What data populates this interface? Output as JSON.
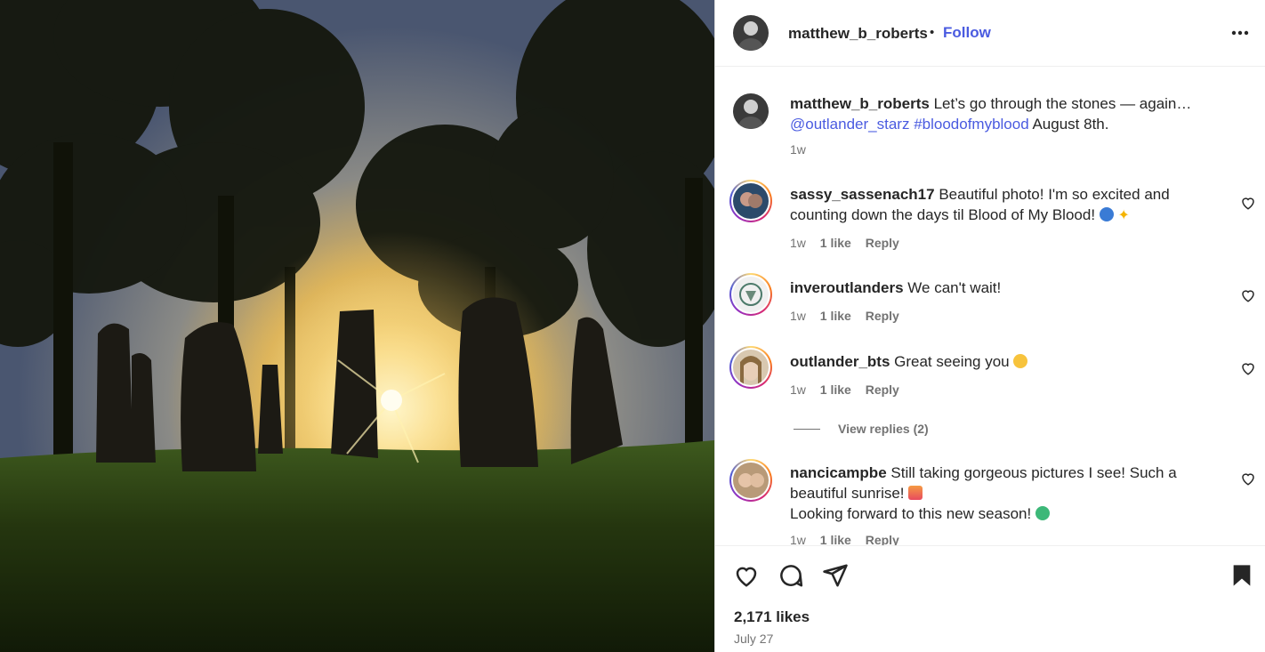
{
  "post": {
    "author": "matthew_b_roberts",
    "separator": "•",
    "follow_label": "Follow",
    "more_icon": "more-horizontal-icon",
    "caption": {
      "username": "matthew_b_roberts",
      "text_1": "Let’s go through the stones — again…",
      "mention": "@outlander_starz",
      "hashtag": "#bloodofmyblood",
      "text_2": "August 8th.",
      "time": "1w"
    },
    "comments": [
      {
        "username": "sassy_sassenach17",
        "line1": "Beautiful photo! I'm so excited and",
        "line2": "counting down the days til Blood of My Blood!",
        "emojis": [
          "blue-heart",
          "sparkles"
        ],
        "time": "1w",
        "likes": "1 like",
        "reply": "Reply"
      },
      {
        "username": "inveroutlanders",
        "line1": "We can't wait!",
        "time": "1w",
        "likes": "1 like",
        "reply": "Reply"
      },
      {
        "username": "outlander_bts",
        "line1": "Great seeing you",
        "emojis": [
          "face-blowing-kiss"
        ],
        "time": "1w",
        "likes": "1 like",
        "reply": "Reply",
        "view_replies": "View replies (2)"
      },
      {
        "username": "nancicampbe",
        "line1": "Still taking gorgeous pictures I see! Such a",
        "line2": "beautiful sunrise!",
        "line3": "Looking forward to this new season!",
        "emojis": [
          "sunrise",
          "green-heart"
        ],
        "time": "1w",
        "likes": "1 like",
        "reply": "Reply"
      }
    ],
    "likes": "2,171 likes",
    "date": "July 27"
  },
  "colors": {
    "link": "#4a5be0",
    "text": "#262626",
    "muted": "#737373",
    "border": "#dbdbdb"
  },
  "icons": [
    "heart-icon",
    "comment-icon",
    "share-icon",
    "bookmark-icon"
  ]
}
